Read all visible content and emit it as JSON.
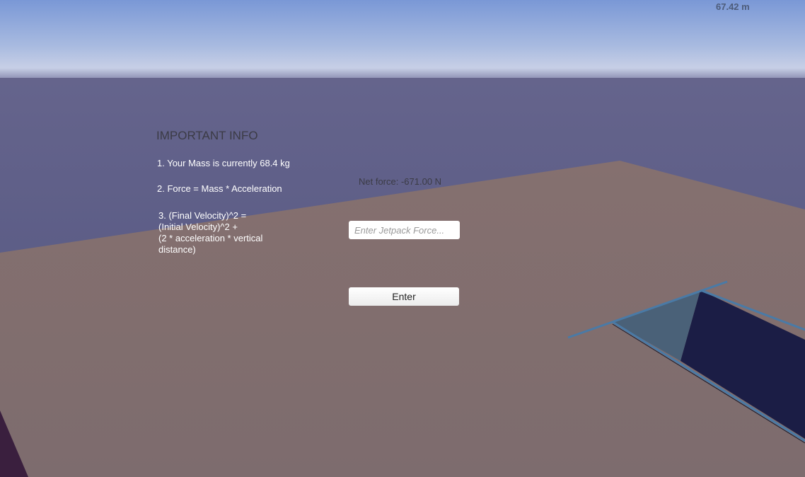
{
  "hud": {
    "altitude": "67.42 m",
    "net_force": "Net force: -671.00 N"
  },
  "info_panel": {
    "title": "IMPORTANT INFO",
    "line1": "1. Your Mass is currently 68.4 kg",
    "line2": "2. Force = Mass * Acceleration",
    "line3_a": "3.  (Final Velocity)^2 =",
    "line3_b": "(Initial Velocity)^2 +",
    "line3_c": "(2 * acceleration * vertical",
    "line3_d": "distance)"
  },
  "jetpack_form": {
    "placeholder": "Enter Jetpack Force...",
    "value": "",
    "enter_label": "Enter"
  },
  "colors": {
    "sky_top": "#7d9ad6",
    "sky_horizon": "#bcc8e4",
    "far_ground": "#5c5c82",
    "ground": "#7f6c6f",
    "ramp_dark": "#1b1d45",
    "ramp_light": "#4a6178",
    "ramp_edge": "#4a7aa6",
    "corner_block": "#3a1f3e"
  }
}
